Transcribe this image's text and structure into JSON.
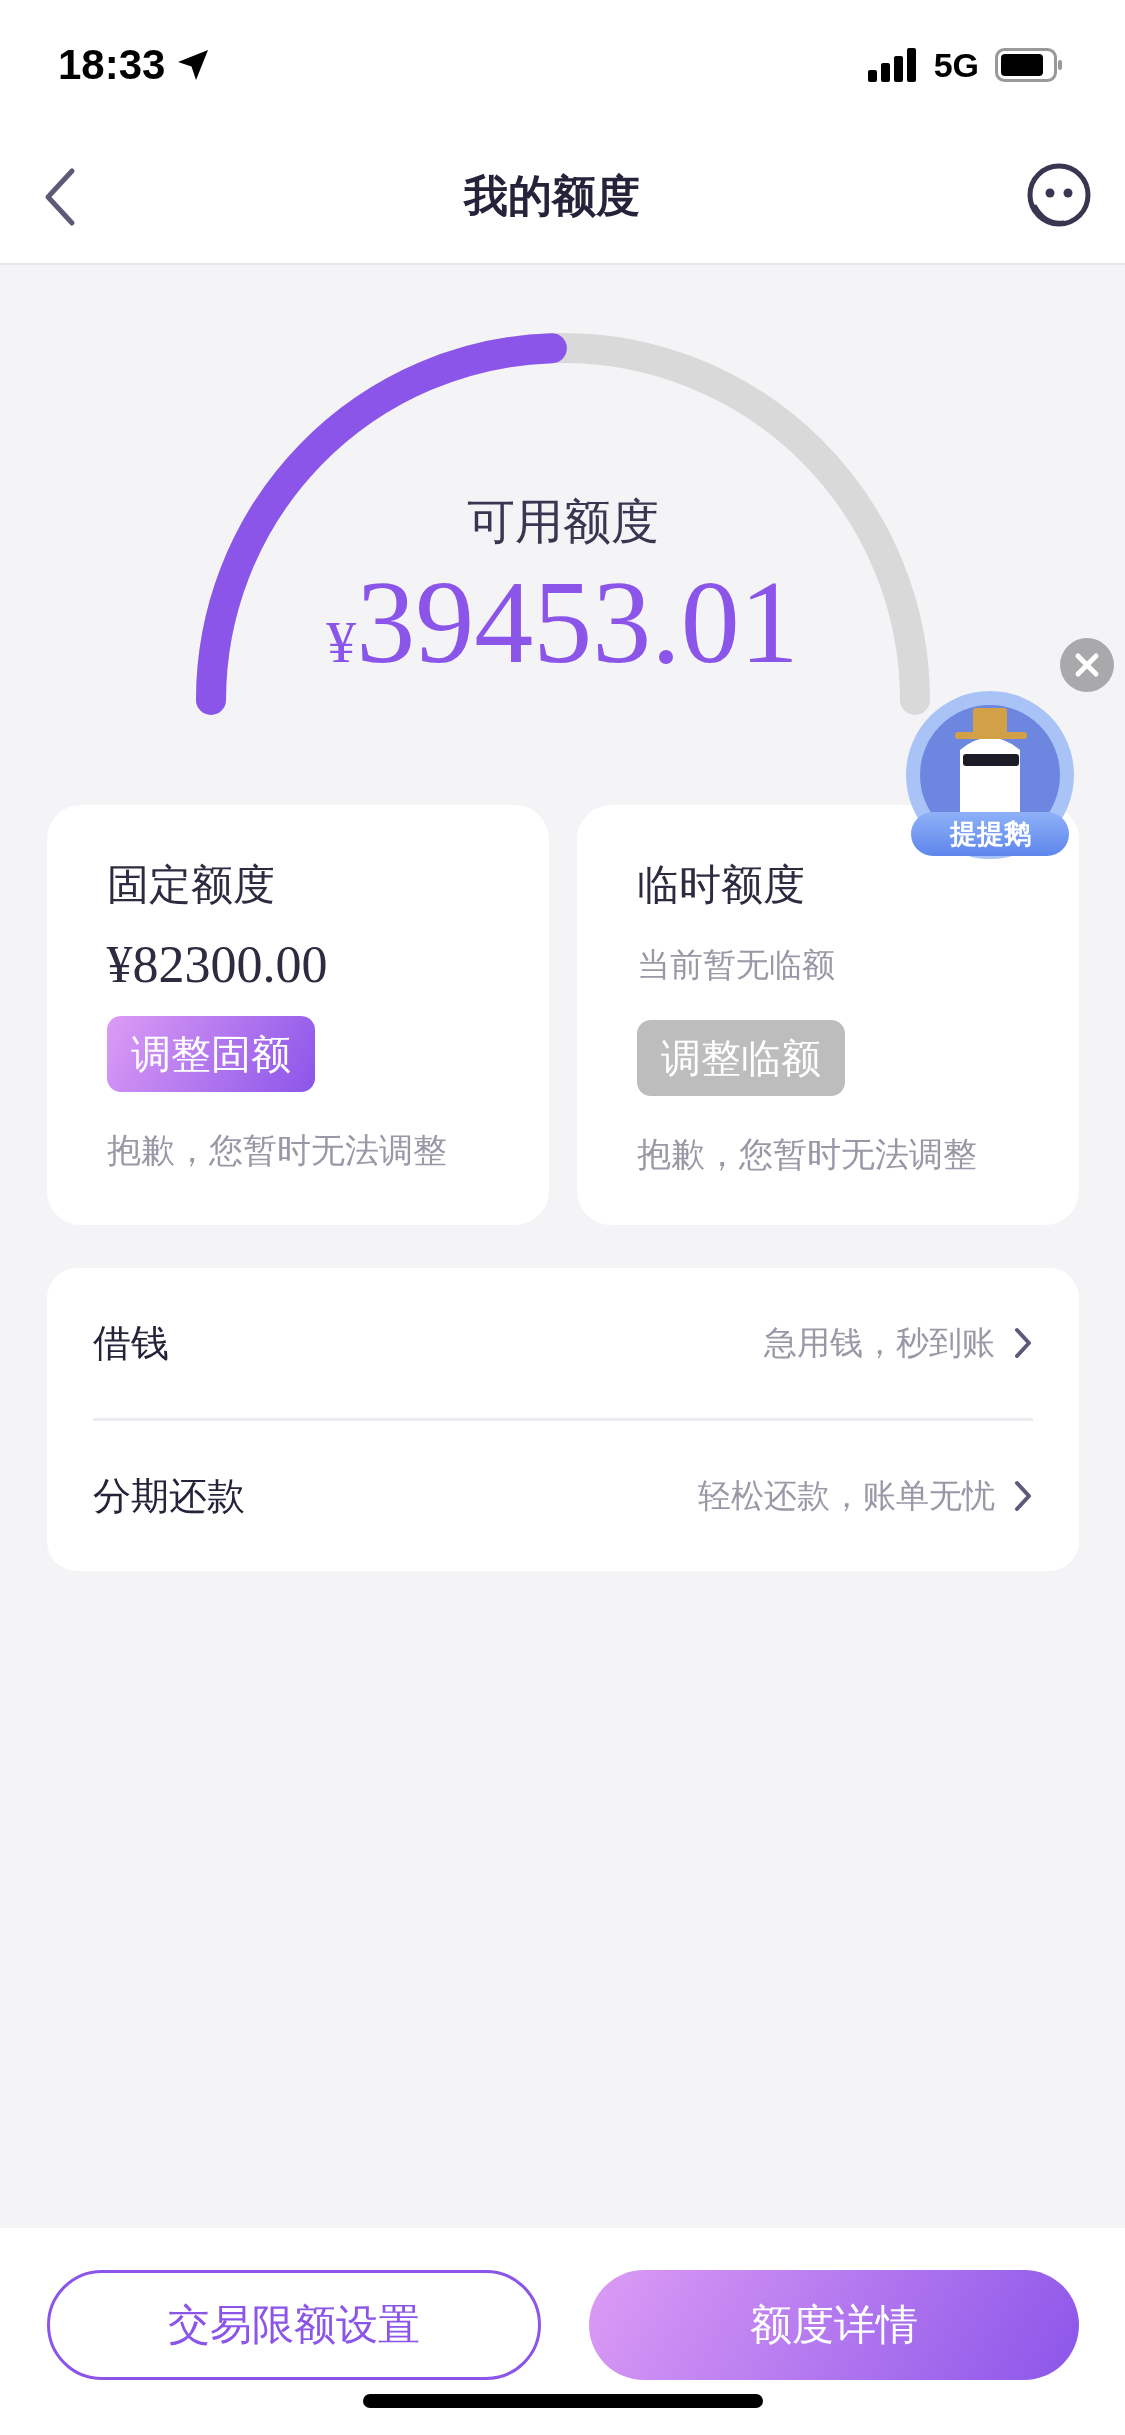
{
  "status_bar": {
    "time": "18:33",
    "network": "5G"
  },
  "header": {
    "title": "我的额度"
  },
  "gauge": {
    "label": "可用额度",
    "currency": "¥",
    "amount": "39453.01"
  },
  "cards": [
    {
      "title": "固定额度",
      "value": "¥82300.00",
      "value_muted": false,
      "button": {
        "label": "调整固额",
        "disabled": false
      },
      "note": "抱歉，您暂时无法调整"
    },
    {
      "title": "临时额度",
      "value": "当前暂无临额",
      "value_muted": true,
      "button": {
        "label": "调整临额",
        "disabled": true
      },
      "note": "抱歉，您暂时无法调整"
    }
  ],
  "list": [
    {
      "label": "借钱",
      "hint": "急用钱，秒到账"
    },
    {
      "label": "分期还款",
      "hint": "轻松还款，账单无忧"
    }
  ],
  "floating_badge": {
    "label": "提提鹅"
  },
  "bottom_buttons": [
    {
      "label": "交易限额设置",
      "kind": "outline"
    },
    {
      "label": "额度详情",
      "kind": "filled"
    }
  ]
}
